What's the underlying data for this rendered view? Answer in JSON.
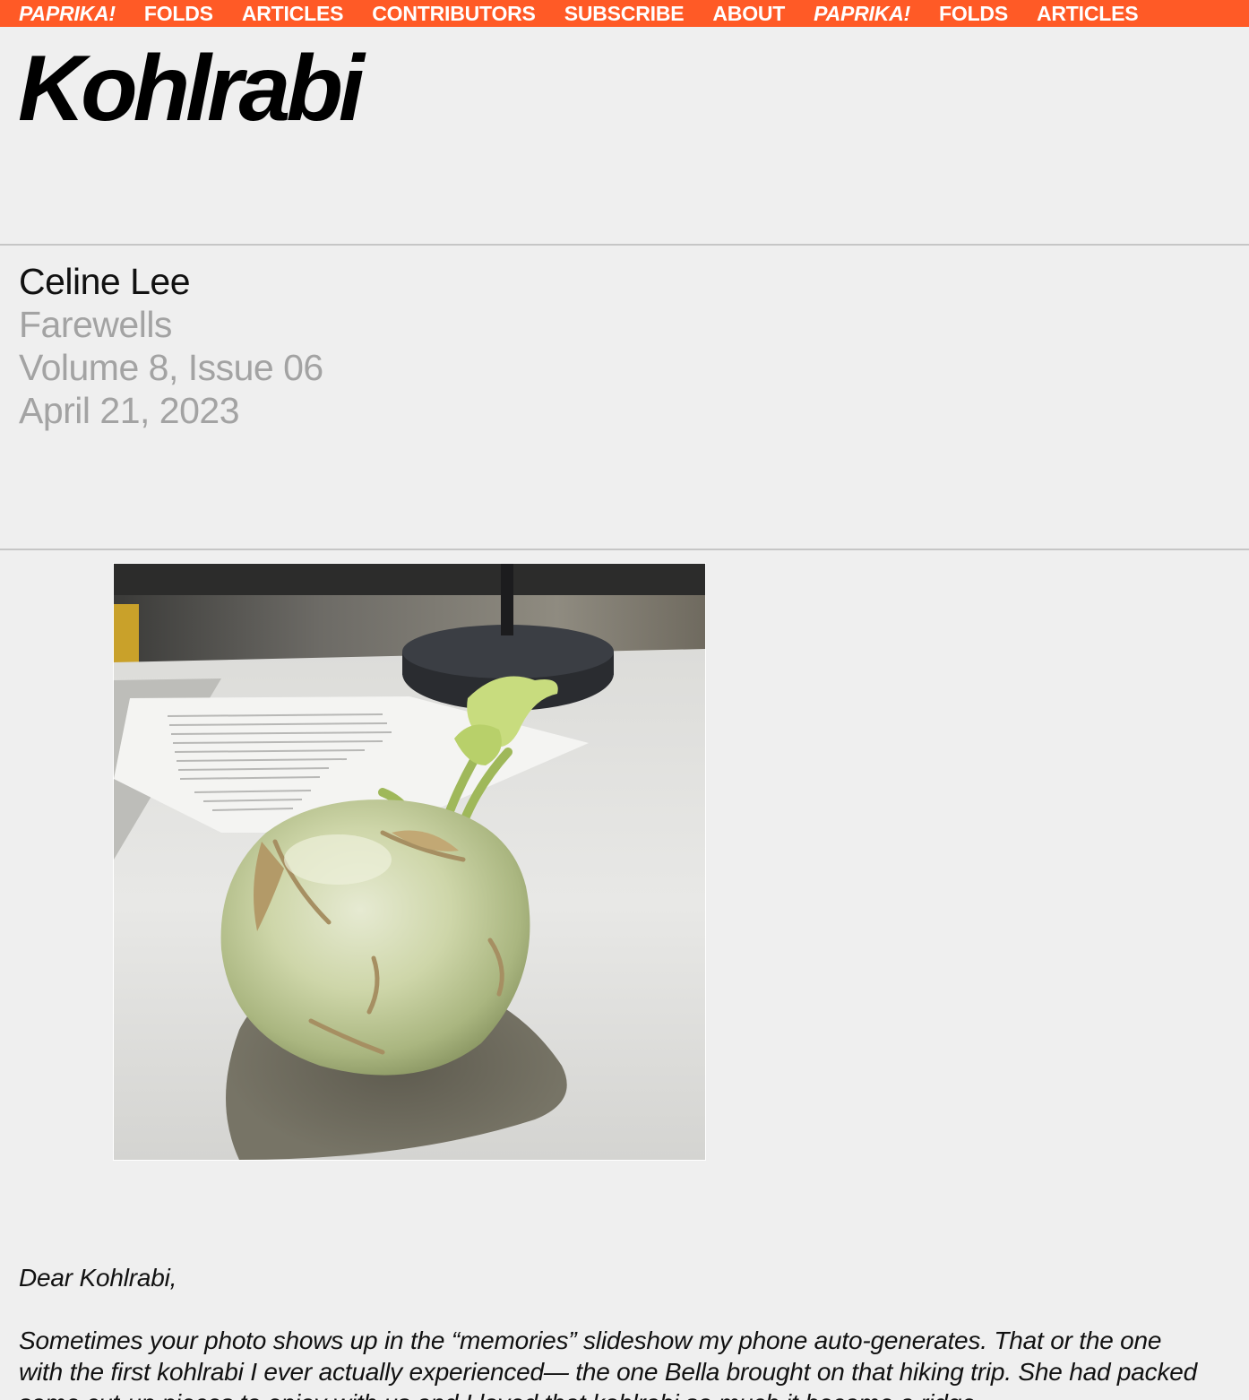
{
  "nav": {
    "items": [
      {
        "label": "PAPRIKA!",
        "brand": true
      },
      {
        "label": "FOLDS",
        "brand": false
      },
      {
        "label": "ARTICLES",
        "brand": false
      },
      {
        "label": "CONTRIBUTORS",
        "brand": false
      },
      {
        "label": "SUBSCRIBE",
        "brand": false
      },
      {
        "label": "ABOUT",
        "brand": false
      },
      {
        "label": "PAPRIKA!",
        "brand": true
      },
      {
        "label": "FOLDS",
        "brand": false
      },
      {
        "label": "ARTICLES",
        "brand": false
      }
    ]
  },
  "article": {
    "title": "Kohlrabi",
    "author": "Celine Lee",
    "section": "Farewells",
    "issue": "Volume 8, Issue 06",
    "date": "April 21, 2023"
  },
  "photo": {
    "subject": "kohlrabi on a desk"
  },
  "letter": {
    "salutation": "Dear Kohlrabi,",
    "body": "Sometimes your photo shows up in the “memories” slideshow my phone auto-generates. That or the one with the first kohlrabi I ever actually experienced— the one Bella brought on that hiking trip. She had packed some cut-up pieces to enjoy with us and I loved that kohlrabi so much it became a ridge"
  },
  "colors": {
    "nav_bg": "#ff5a26",
    "nav_text": "#ffffff",
    "page_bg": "#efefef",
    "muted_text": "#a3a3a3"
  }
}
